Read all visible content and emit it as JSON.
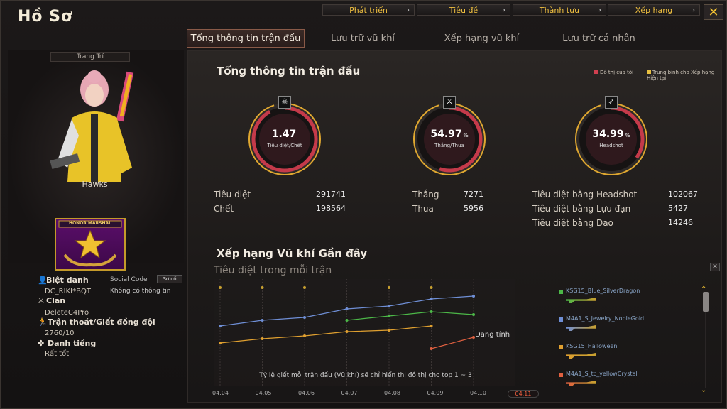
{
  "window": {
    "title": "Hồ Sơ"
  },
  "top_nav": [
    {
      "label": "Phát triển"
    },
    {
      "label": "Tiêu đề"
    },
    {
      "label": "Thành tựu"
    },
    {
      "label": "Xếp hạng"
    }
  ],
  "tabs": [
    {
      "label": "Tổng thông tin trận đấu",
      "active": true
    },
    {
      "label": "Lưu trữ vũ khí"
    },
    {
      "label": "Xếp hạng vũ khí"
    },
    {
      "label": "Lưu trữ cá nhân"
    }
  ],
  "profile": {
    "decor_label": "Trang Trí",
    "character_name": "Hawks",
    "badge_text": "HONOR MARSHAL",
    "nickname_label": "Biệt danh",
    "nickname": "DC_RIKI*BQT",
    "social_code_label": "Social Code",
    "social_code_btn": "Sơ cố",
    "no_info": "Không có thông tin",
    "clan_label": "Clan",
    "clan": "DeleteC4Pro",
    "escape_label": "Trận thoát/Giết đồng đội",
    "escape_value": "2760/10",
    "reputation_label": "Danh tiếng",
    "reputation_value": "Rất tốt"
  },
  "summary": {
    "title": "Tổng thông tin trận đấu",
    "legend_mine": "Đồ thị của tôi",
    "legend_avg": "Trung bình cho Xếp hạng Hiện tại",
    "gauges": [
      {
        "value": "1.47",
        "unit": "",
        "label": "Tiêu diệt/Chết",
        "icon": "skull-icon",
        "fill": 0.92
      },
      {
        "value": "54.97",
        "unit": "%",
        "label": "Thắng/Thua",
        "icon": "crossed-guns-icon",
        "fill": 0.55
      },
      {
        "value": "34.99",
        "unit": "%",
        "label": "Headshot",
        "icon": "rifle-icon",
        "fill": 0.35
      }
    ],
    "stats_col1": [
      {
        "label": "Tiêu diệt",
        "value": "291741"
      },
      {
        "label": "Chết",
        "value": "198564"
      }
    ],
    "stats_col2": [
      {
        "label": "Thắng",
        "value": "7271"
      },
      {
        "label": "Thua",
        "value": "5956"
      }
    ],
    "stats_col3": [
      {
        "label": "Tiêu diệt bằng Headshot",
        "value": "102067"
      },
      {
        "label": "Tiêu diệt bằng Lựu đạn",
        "value": "5427"
      },
      {
        "label": "Tiêu diệt bằng Dao",
        "value": "14246"
      }
    ]
  },
  "weapons": {
    "title": "Xếp hạng Vũ khí Gần đây",
    "subtitle": "Tiêu diệt trong mỗi trận",
    "note": "Tỷ lệ giết mỗi trận đấu (Vũ khí) sẽ chỉ hiển thị đồ thị cho top 1 ~ 3",
    "in_progress": "Đang tính",
    "list": [
      {
        "name": "KSG15_Blue_SilverDragon",
        "color": "#4cb848"
      },
      {
        "name": "M4A1_S_Jewelry_NobleGold",
        "color": "#6f8fd6"
      },
      {
        "name": "KSG15_Halloween",
        "color": "#e0a030"
      },
      {
        "name": "M4A1_S_tc_yellowCrystal",
        "color": "#e06040"
      }
    ]
  },
  "chart_data": {
    "type": "line",
    "x": [
      "04.04",
      "04.05",
      "04.06",
      "04.07",
      "04.08",
      "04.09",
      "04.10",
      "04.11"
    ],
    "active_x": "04.11",
    "series": [
      {
        "name": "KSG15_Blue_SilverDragon",
        "color": "#4cb848",
        "values": [
          null,
          null,
          null,
          3.6,
          3.9,
          4.2,
          4.0,
          null
        ]
      },
      {
        "name": "M4A1_S_Jewelry_NobleGold",
        "color": "#6f8fd6",
        "values": [
          3.2,
          3.6,
          3.8,
          4.4,
          4.6,
          5.1,
          5.3,
          null
        ]
      },
      {
        "name": "KSG15_Halloween",
        "color": "#e0a030",
        "values": [
          2.0,
          2.3,
          2.5,
          2.8,
          2.9,
          3.2,
          null,
          null
        ]
      },
      {
        "name": "M4A1_S_tc_yellowCrystal",
        "color": "#e06040",
        "values": [
          null,
          null,
          null,
          null,
          null,
          1.6,
          2.4,
          null
        ]
      }
    ],
    "top_markers": [
      "04.04",
      "04.05",
      "04.06",
      "04.08",
      "04.09"
    ]
  }
}
